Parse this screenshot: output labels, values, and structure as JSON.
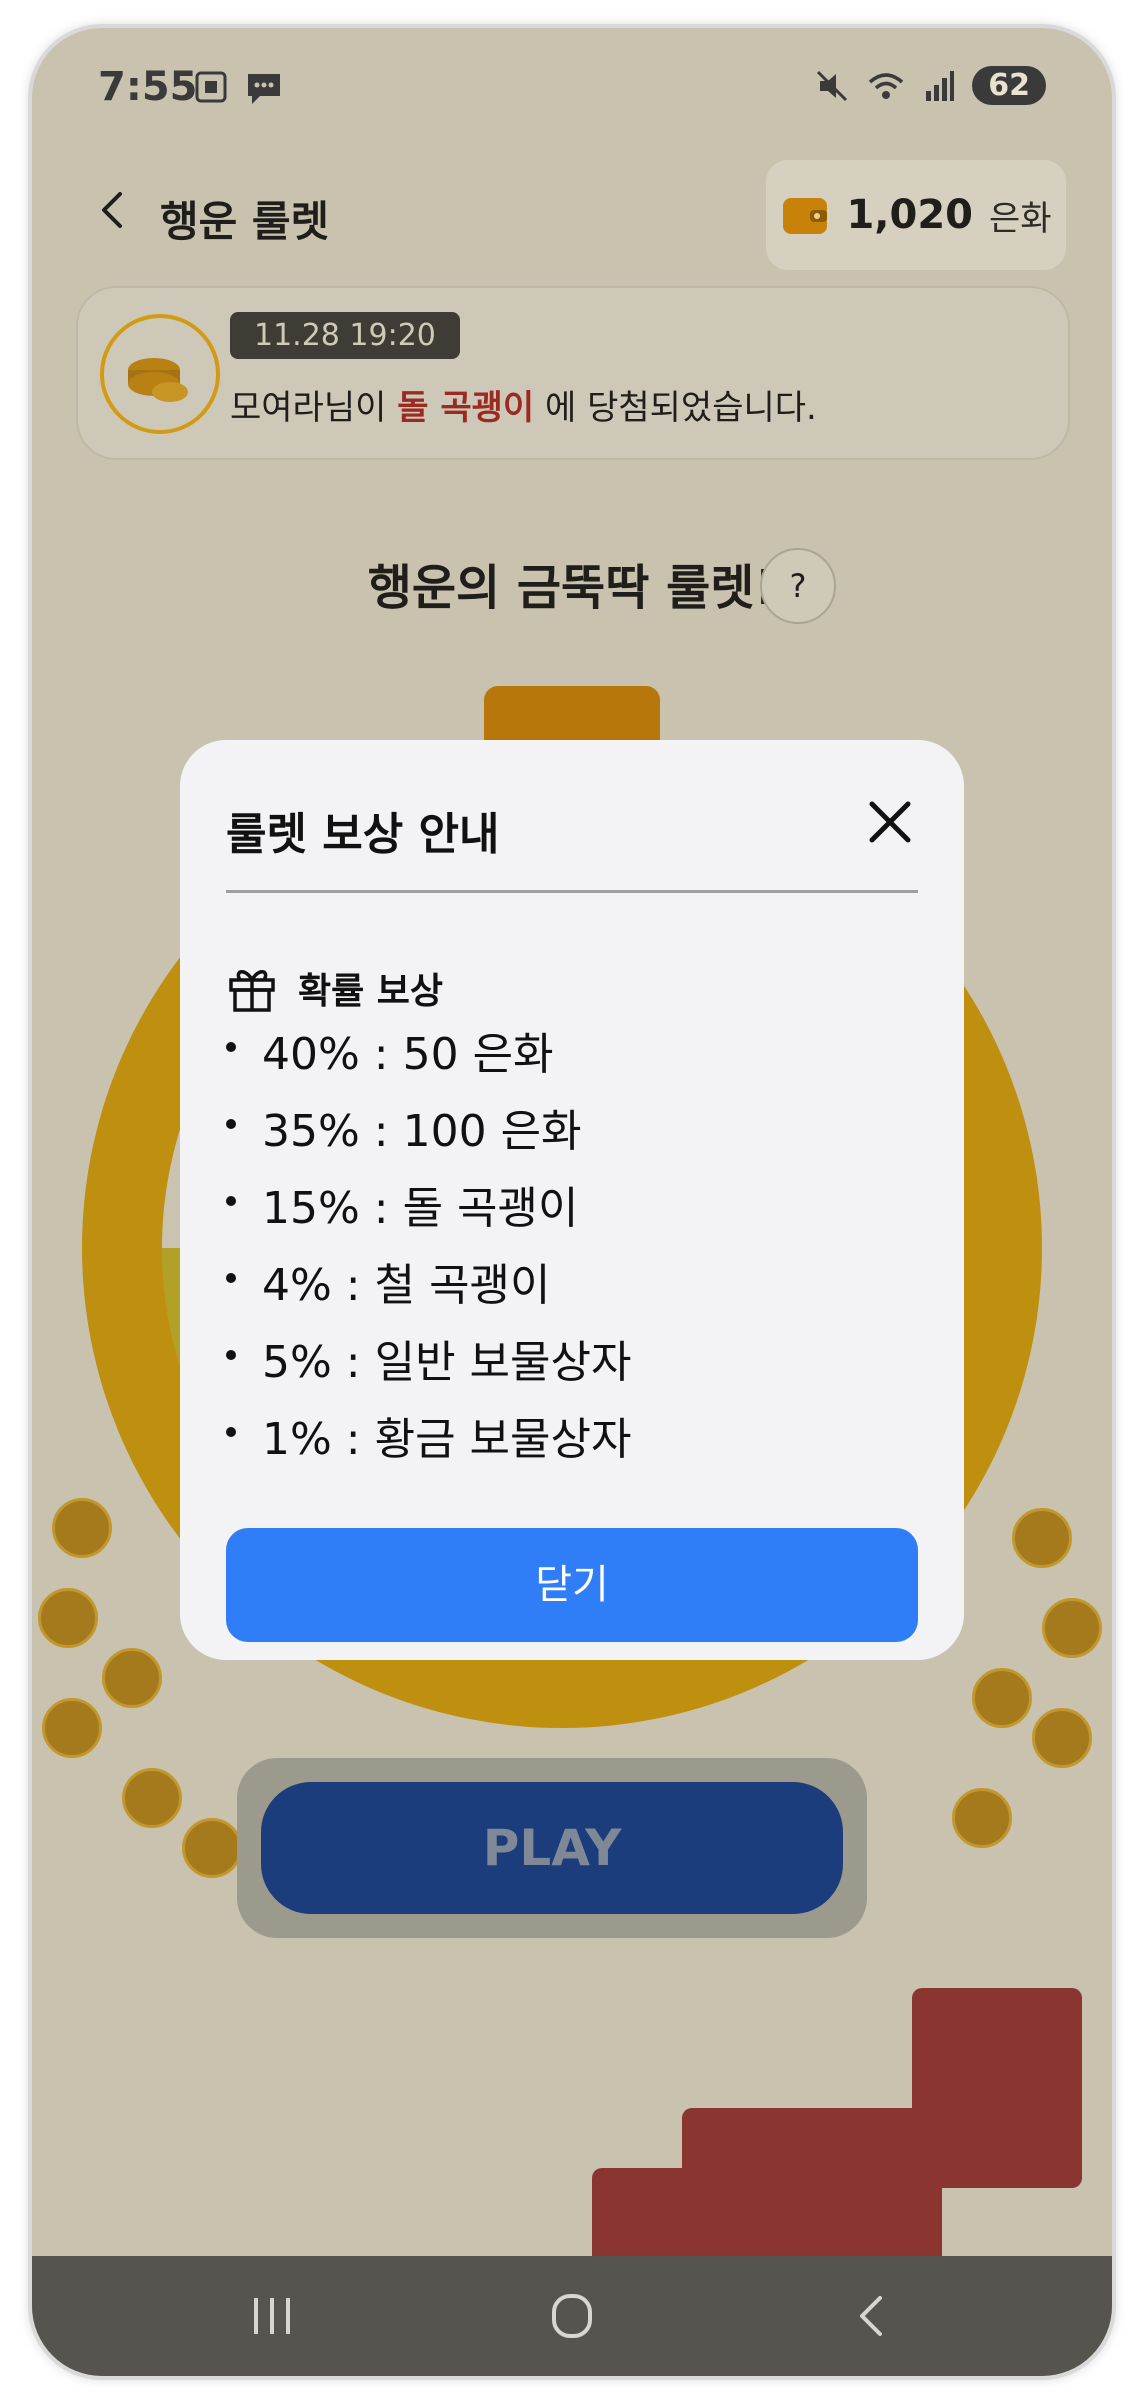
{
  "status_bar": {
    "time": "7:55",
    "battery": "62"
  },
  "header": {
    "title": "행운 룰렛",
    "balance": "1,020",
    "balance_unit": "은화"
  },
  "notice": {
    "time": "11.28 19:20",
    "user_text": "모여라님이 ",
    "prize": "돌 곡괭이",
    "suffix": " 에 당첨되었습니다."
  },
  "game": {
    "title": "행운의 금뚝딱 룰렛!",
    "help_label": "?",
    "play_label": "PLAY"
  },
  "modal": {
    "title": "룰렛 보상 안내",
    "section_title": "확률 보상",
    "rewards": [
      "40% : 50 은화",
      "35% : 100 은화",
      "15% : 돌 곡괭이",
      "4% : 철 곡괭이",
      "5% : 일반 보물상자",
      "1% : 황금 보물상자"
    ],
    "close_label": "닫기"
  },
  "colors": {
    "accent_blue": "#2f7ef7",
    "highlight_red": "#9b2a23",
    "gold": "#d29b13"
  }
}
